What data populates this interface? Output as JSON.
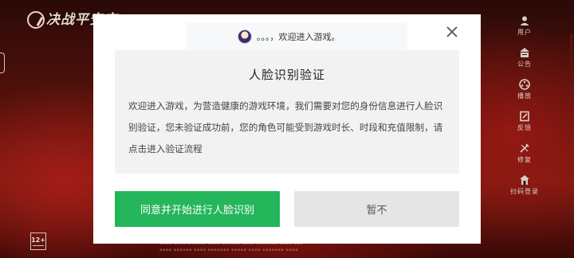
{
  "game": {
    "logo_text": "决战平安京",
    "side_menu": [
      {
        "icon": "user-icon",
        "label": "用户"
      },
      {
        "icon": "announcement-icon",
        "label": "公告"
      },
      {
        "icon": "replay-icon",
        "label": "播放"
      },
      {
        "icon": "feedback-icon",
        "label": "反馈"
      },
      {
        "icon": "repair-icon",
        "label": "修复"
      },
      {
        "icon": "scan-login-icon",
        "label": "扫码登录"
      }
    ],
    "age_rating": "12+"
  },
  "dialog": {
    "toast_text": "。。。，欢迎进入游戏。",
    "title": "人脸识别验证",
    "body": "欢迎进入游戏，为营造健康的游戏环境，我们需要对您的身份信息进行人脸识别验证，您未验证成功前，您的角色可能受到游戏时长、时段和充值限制，请点击进入验证流程",
    "agree_button": "同意并开始进行人脸识别",
    "later_button": "暂不"
  },
  "colors": {
    "primary_green": "#25b55b",
    "secondary_gray": "#e5e5e5",
    "content_bg": "#f2f2f2"
  }
}
